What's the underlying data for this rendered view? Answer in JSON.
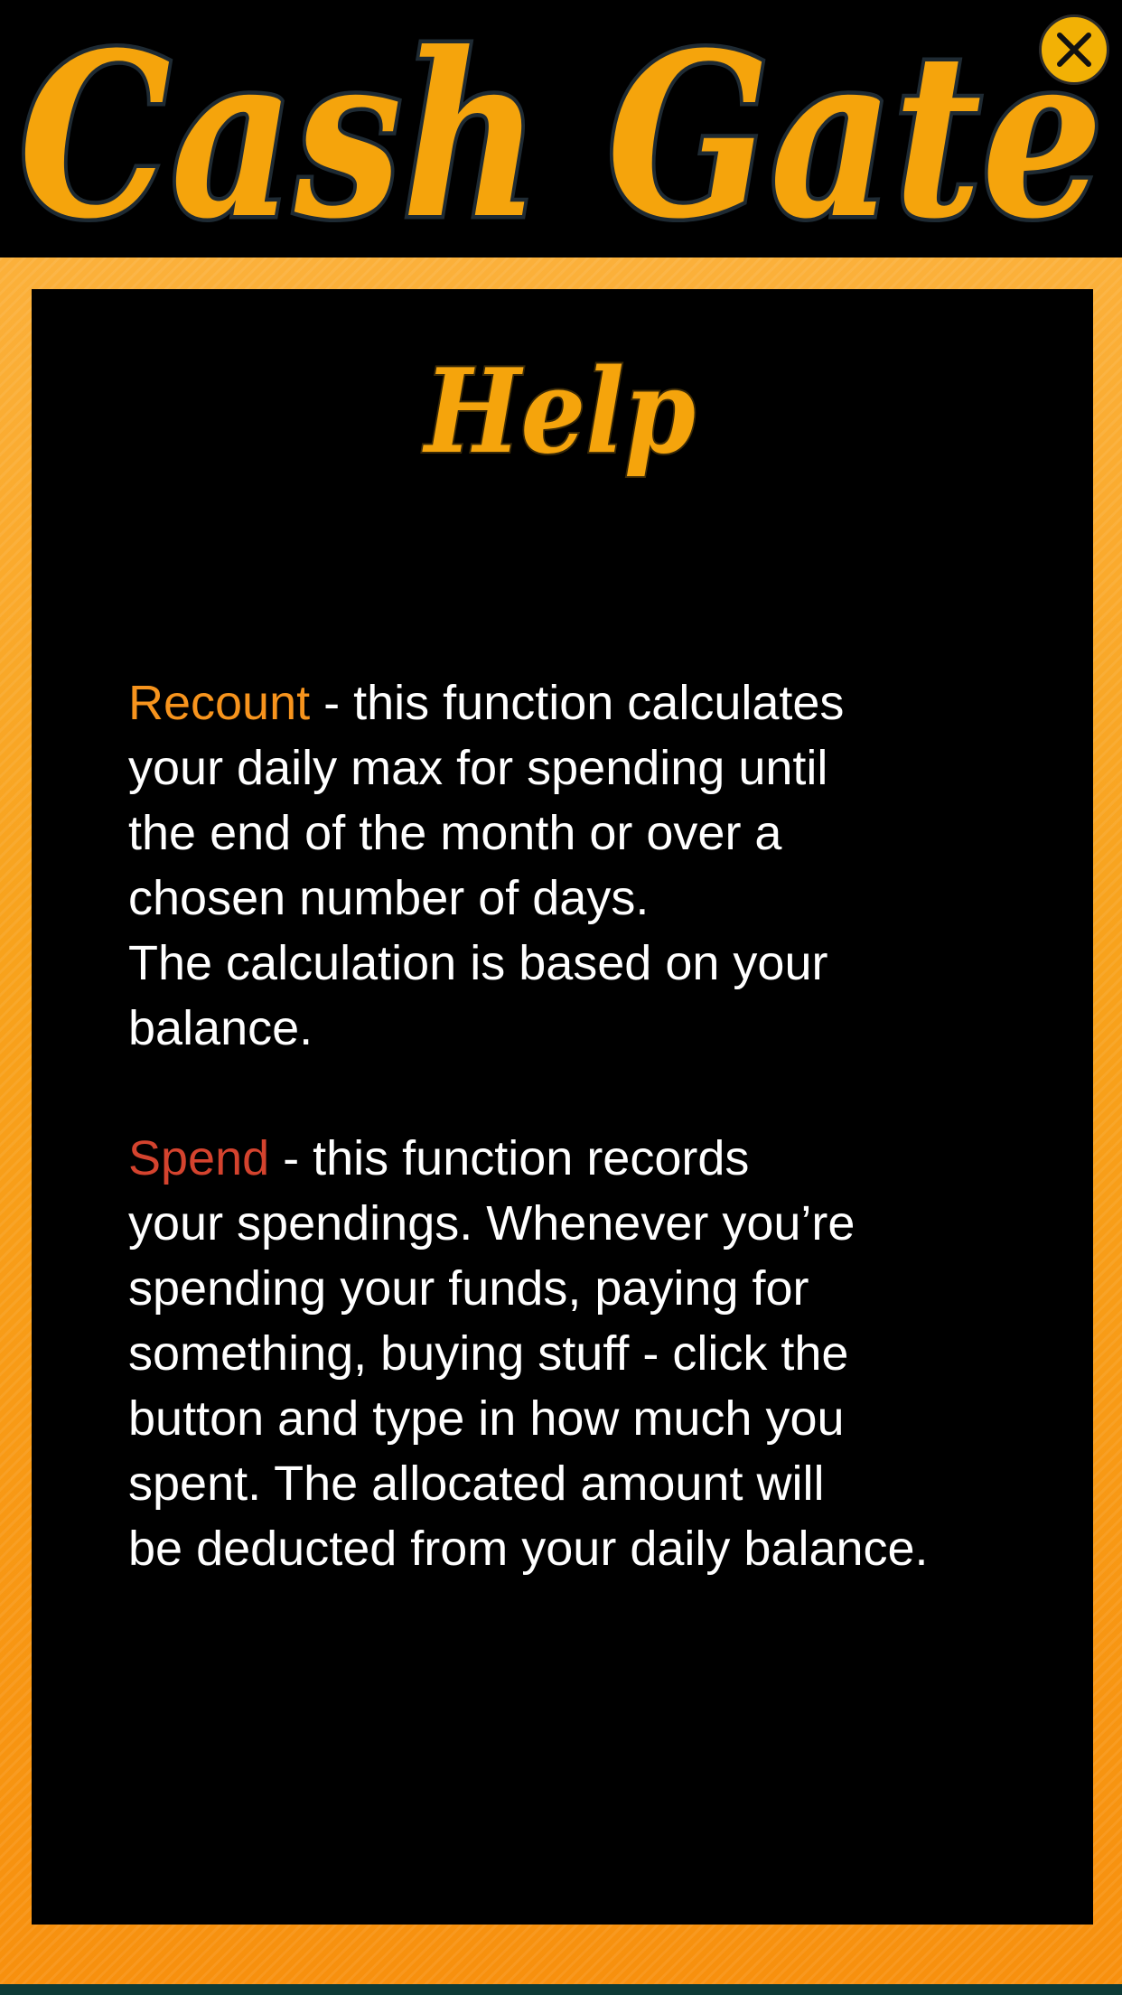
{
  "app": {
    "title": "Cash Gate"
  },
  "colors": {
    "accent": "#f5a40c",
    "frame": "#f89e0e",
    "recount": "#f7941d",
    "spend": "#d4432e",
    "text": "#ffffff",
    "background": "#000000"
  },
  "header": {
    "close_icon": "close-icon"
  },
  "help": {
    "title": "Help",
    "sections": [
      {
        "keyword": "Recount",
        "text": " - this function calculates\nyour daily max for spending until\nthe end of the month or over a\nchosen number of days.\nThe calculation is based on your\nbalance."
      },
      {
        "keyword": "Spend",
        "text": " - this function records\nyour spendings. Whenever you’re\nspending your funds, paying for\nsomething, buying stuff - click the\nbutton and type in how much you\nspent. The allocated amount will\nbe deducted from your daily balance."
      }
    ]
  }
}
